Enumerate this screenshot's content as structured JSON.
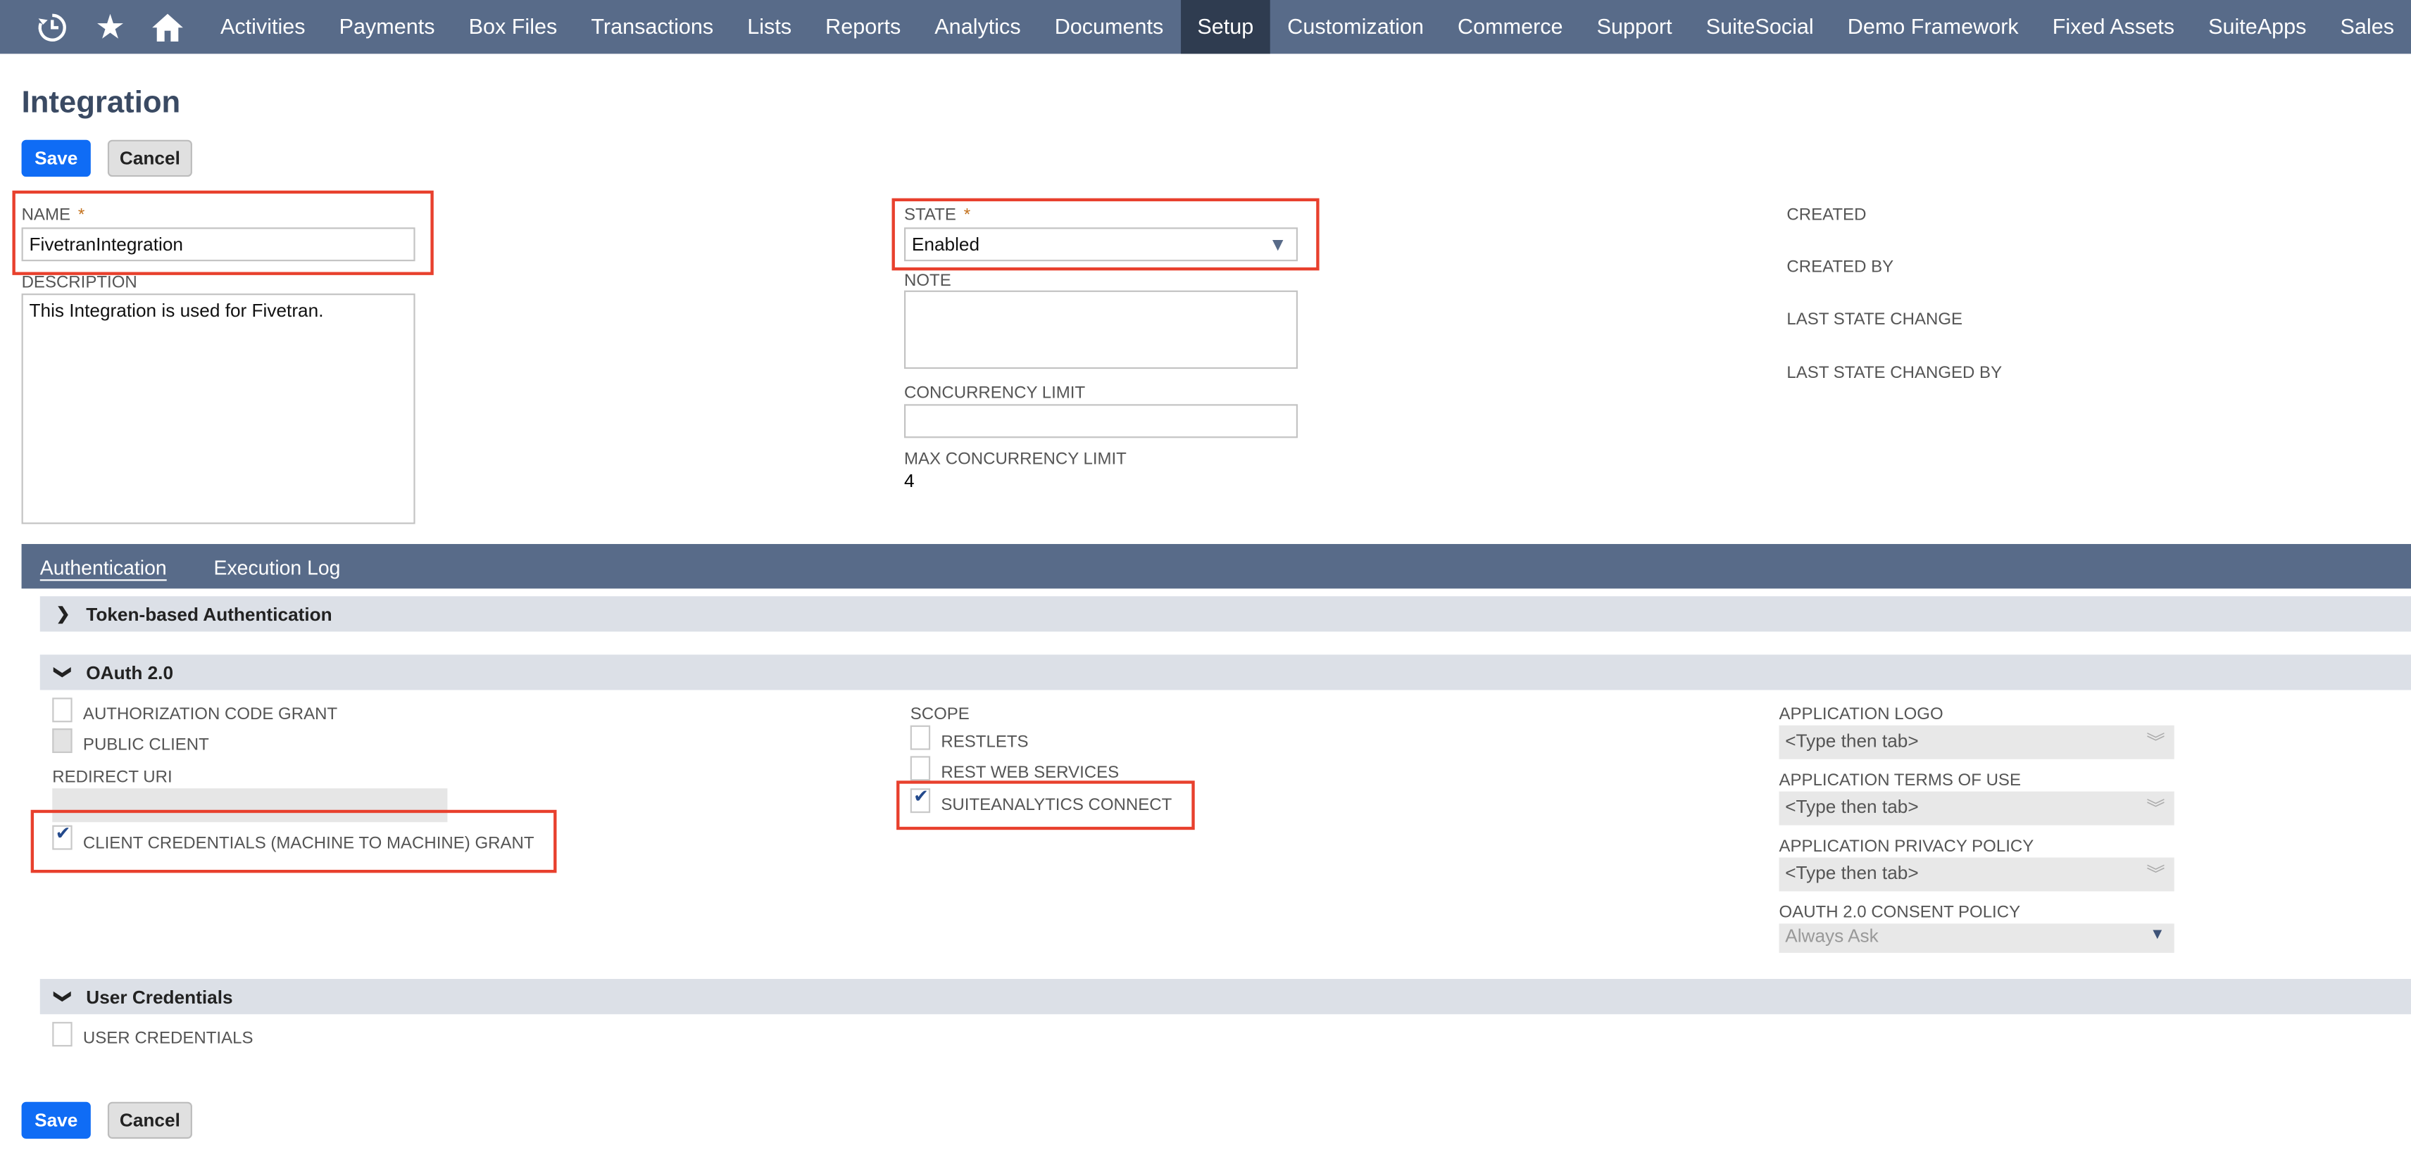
{
  "nav": {
    "icons": [
      "recent-icon",
      "star-icon",
      "home-icon"
    ],
    "items": [
      "Activities",
      "Payments",
      "Box Files",
      "Transactions",
      "Lists",
      "Reports",
      "Analytics",
      "Documents",
      "Setup",
      "Customization",
      "Commerce",
      "Support",
      "SuiteSocial",
      "Demo Framework",
      "Fixed Assets",
      "SuiteApps",
      "Sales"
    ],
    "active": "Setup",
    "color": "#586b89"
  },
  "page": {
    "title": "Integration",
    "save_label": "Save",
    "cancel_label": "Cancel"
  },
  "form": {
    "name_label": "NAME",
    "name_value": "FivetranIntegration",
    "required_mark": "*",
    "description_label": "DESCRIPTION",
    "description_value": "This Integration is used for Fivetran.",
    "state_label": "STATE",
    "state_value": "Enabled",
    "note_label": "NOTE",
    "note_value": "",
    "concurrency_label": "CONCURRENCY LIMIT",
    "concurrency_value": "",
    "max_concurrency_label": "MAX CONCURRENCY LIMIT",
    "max_concurrency_value": "4",
    "created_label": "CREATED",
    "created_by_label": "CREATED BY",
    "last_state_change_label": "LAST STATE CHANGE",
    "last_state_changed_by_label": "LAST STATE CHANGED BY"
  },
  "tabs": [
    "Authentication",
    "Execution Log"
  ],
  "sections": {
    "token": "Token-based Authentication",
    "oauth": "OAuth 2.0",
    "user": "User Credentials"
  },
  "oauth": {
    "auth_code_grant": {
      "label": "AUTHORIZATION CODE GRANT",
      "checked": false
    },
    "public_client": {
      "label": "PUBLIC CLIENT",
      "checked": false,
      "disabled": true
    },
    "redirect_uri_label": "REDIRECT URI",
    "client_credentials": {
      "label": "CLIENT CREDENTIALS (MACHINE TO MACHINE) GRANT",
      "checked": true
    },
    "scope_label": "SCOPE",
    "restlets": {
      "label": "RESTLETS",
      "checked": false
    },
    "rest_web_services": {
      "label": "REST WEB SERVICES",
      "checked": false
    },
    "suiteanalytics": {
      "label": "SUITEANALYTICS CONNECT",
      "checked": true
    },
    "app_logo_label": "APPLICATION LOGO",
    "app_terms_label": "APPLICATION TERMS OF USE",
    "app_privacy_label": "APPLICATION PRIVACY POLICY",
    "placeholder": "<Type then tab>",
    "consent_label": "OAUTH 2.0 CONSENT POLICY",
    "consent_value": "Always Ask"
  },
  "user_credentials": {
    "label": "USER CREDENTIALS",
    "checked": false
  },
  "highlight_color": "#e8402d"
}
